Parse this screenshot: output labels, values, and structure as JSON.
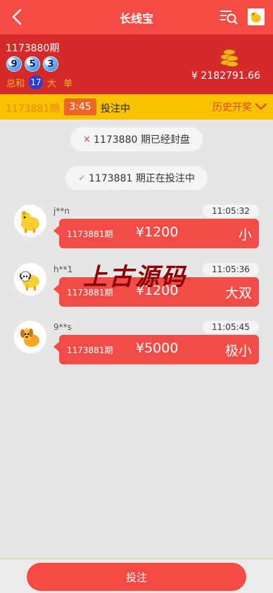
{
  "header": {
    "title": "长线宝"
  },
  "draw": {
    "issue": "1173880期",
    "balls": [
      "9",
      "5",
      "3"
    ],
    "sum_label": "总和",
    "sum_value": "17",
    "size": "大",
    "odd_even": "单",
    "balance": "¥ 2182791.66"
  },
  "status": {
    "issue": "1173881期",
    "timer": "3:45",
    "state": "投注中",
    "history_label": "历史开奖"
  },
  "system_messages": [
    {
      "icon": "×",
      "text": "1173880 期已经封盘"
    },
    {
      "icon": "✓",
      "text": "1173881 期正在投注中"
    }
  ],
  "bets": [
    {
      "user": "j**n",
      "time": "11:05:32",
      "issue": "1173881期",
      "amount": "¥1200",
      "type": "小"
    },
    {
      "user": "h**1",
      "time": "11:05:36",
      "issue": "1173881期",
      "amount": "¥1200",
      "type": "大双"
    },
    {
      "user": "9**s",
      "time": "11:05:45",
      "issue": "1173881期",
      "amount": "¥5000",
      "type": "极小"
    }
  ],
  "watermark": "上古源码",
  "bottom": {
    "bet_label": "投注"
  },
  "colors": {
    "header": "#f44b45",
    "draw_panel": "#d42a2a",
    "status_bar": "#f7c200",
    "bubble": "#f24c48"
  }
}
